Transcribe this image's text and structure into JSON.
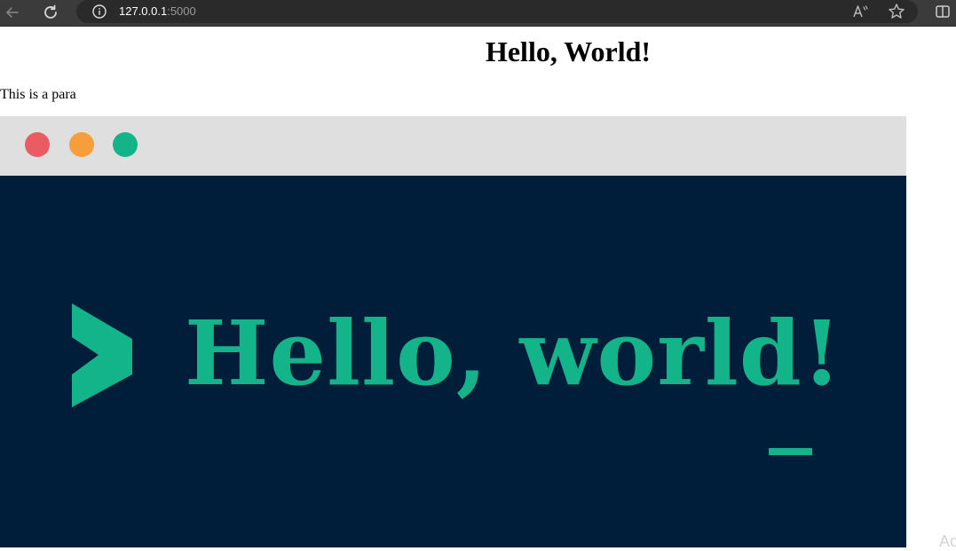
{
  "browser": {
    "address_host": "127.0.0.1",
    "address_port": ":5000",
    "icons": {
      "back": "back-arrow-icon",
      "refresh": "refresh-icon",
      "info": "info-icon",
      "read_aloud": "read-aloud-icon",
      "favorite": "star-icon",
      "split_screen": "split-screen-icon"
    },
    "read_aloud_label": "A⁾"
  },
  "page": {
    "heading": "Hello, World!",
    "paragraph": "This is a para"
  },
  "hero": {
    "text": "Hello, world!",
    "colors": {
      "titlebar": "#dfdfdf",
      "background": "#001e3a",
      "accent": "#14b48b",
      "dot_red": "#eb5b62",
      "dot_orange": "#f69e3a",
      "dot_green": "#14b48b"
    }
  },
  "corner_hint": "Ac"
}
